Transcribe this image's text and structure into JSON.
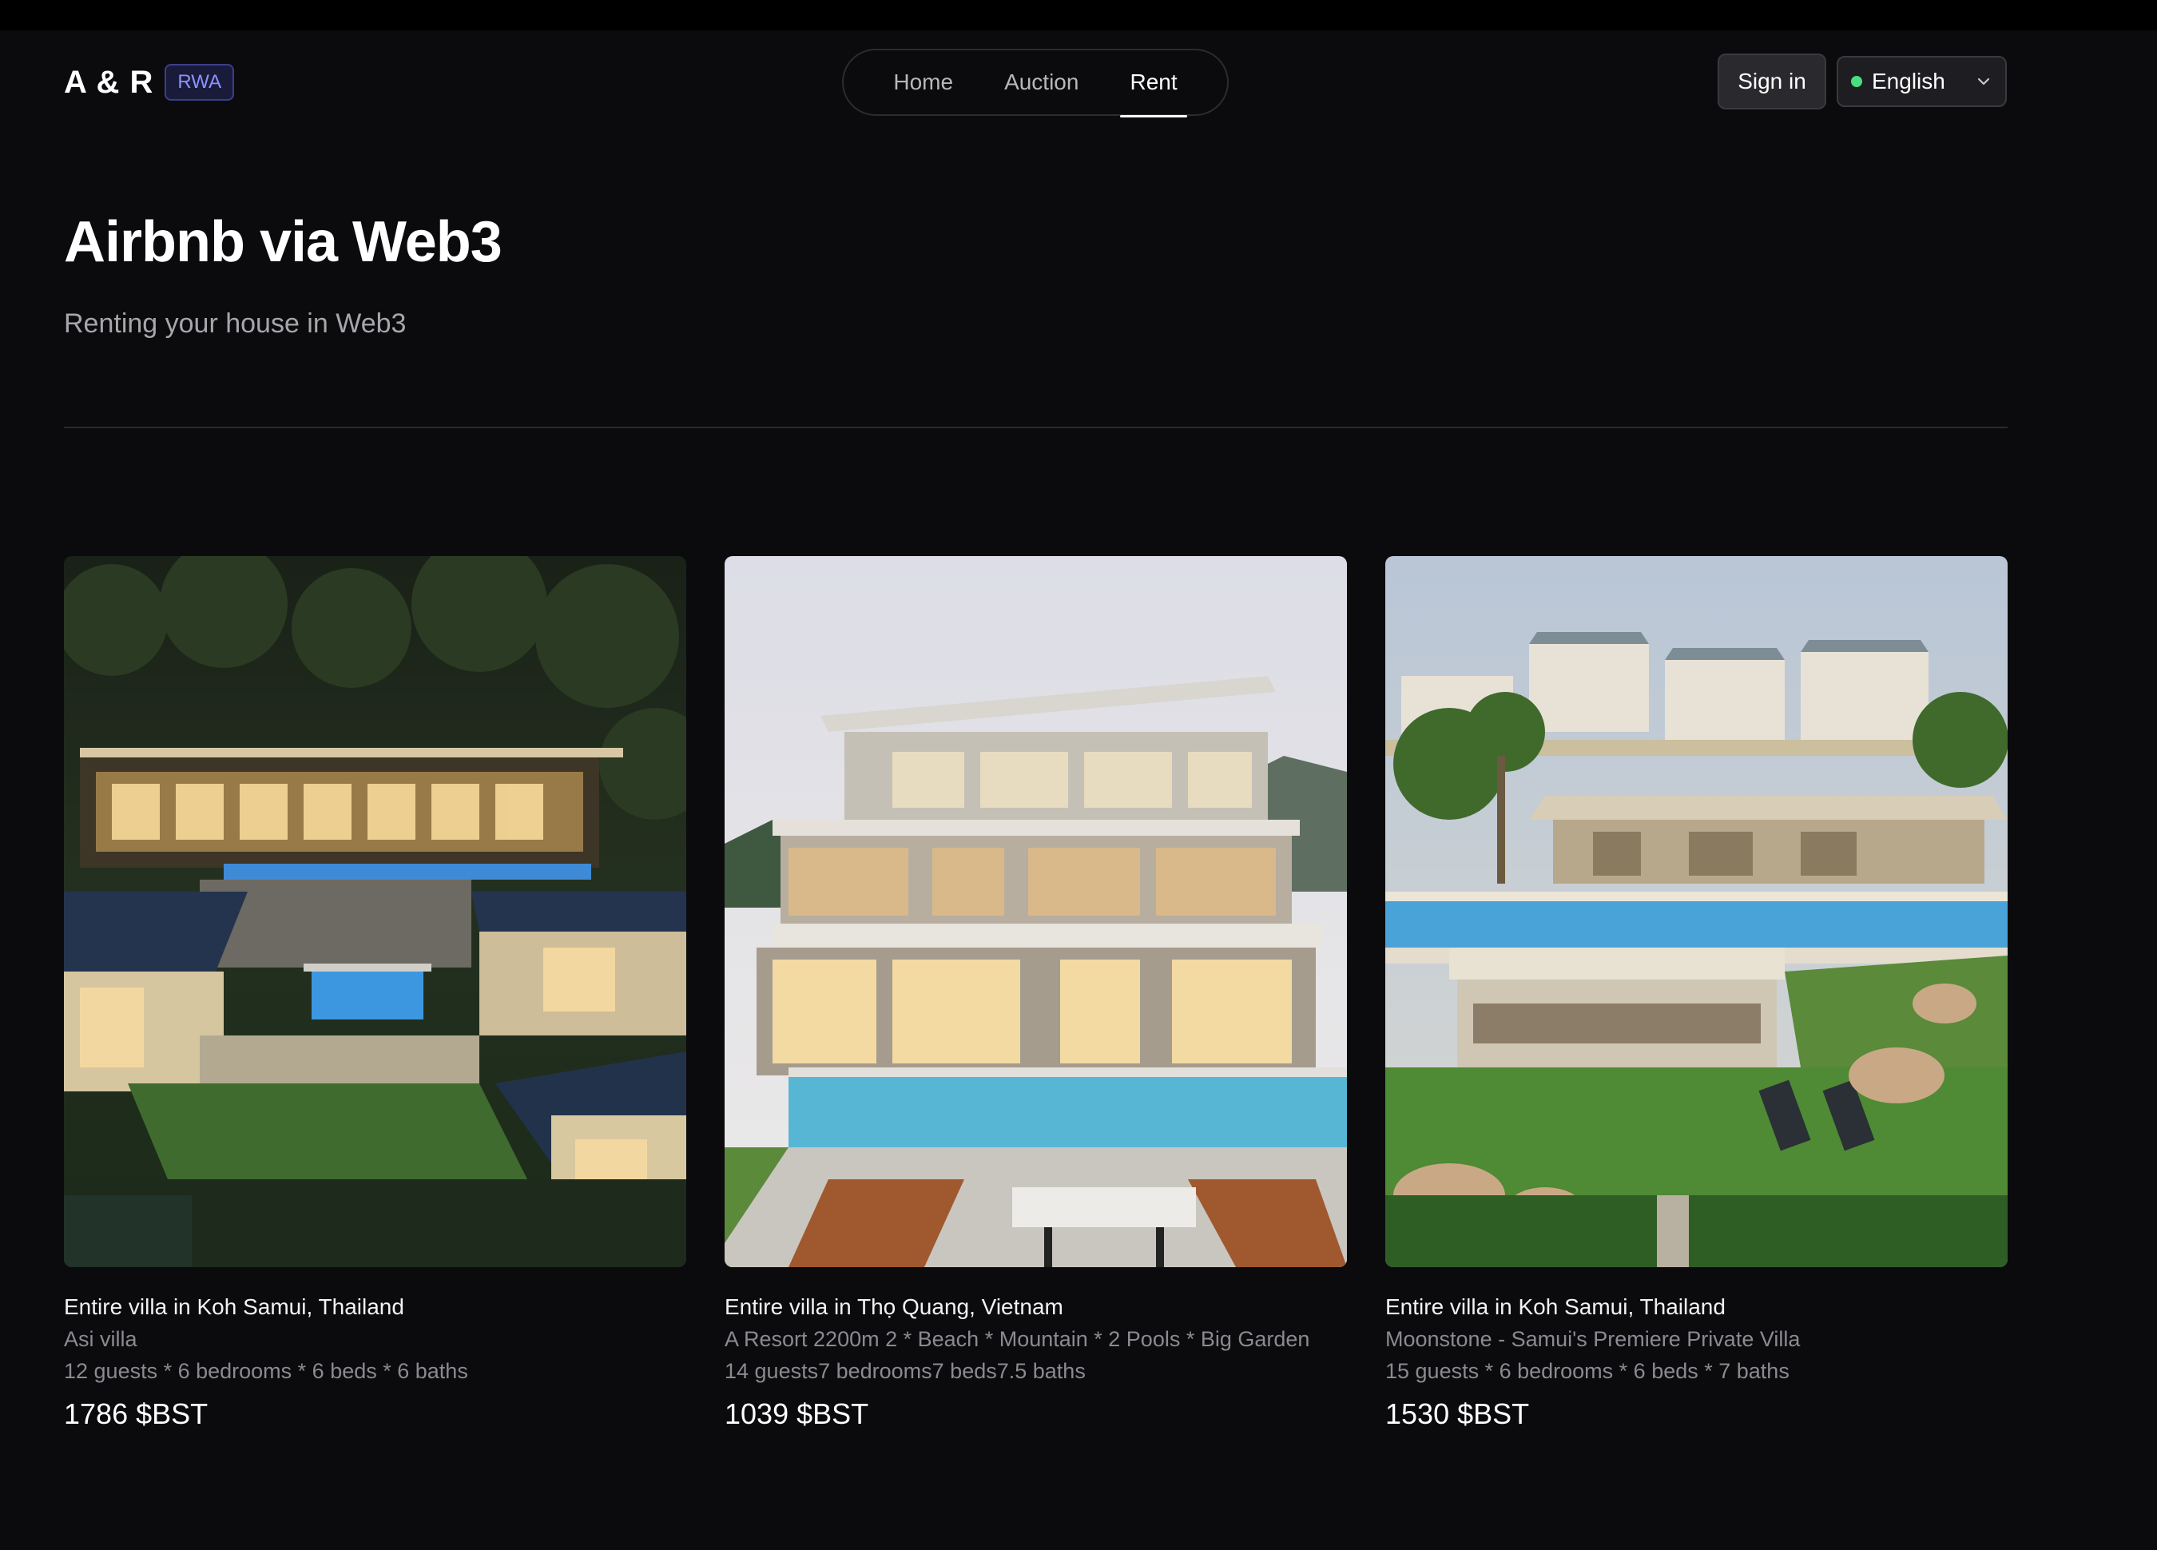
{
  "header": {
    "brand": "A & R",
    "badge": "RWA",
    "nav": [
      {
        "label": "Home",
        "active": false
      },
      {
        "label": "Auction",
        "active": false
      },
      {
        "label": "Rent",
        "active": true
      }
    ],
    "sign_in": "Sign in",
    "language": {
      "selected": "English",
      "status_color": "#4ade80"
    }
  },
  "hero": {
    "title": "Airbnb via Web3",
    "subtitle": "Renting your house in Web3"
  },
  "listings": [
    {
      "title": "Entire villa in Koh Samui, Thailand",
      "name": "Asi villa",
      "details": "12 guests * 6 bedrooms * 6 beds * 6 baths",
      "price": "1786 $BST"
    },
    {
      "title": "Entire villa in Thọ Quang, Vietnam",
      "name": "A Resort 2200m 2 * Beach * Mountain * 2 Pools * Big Garden",
      "details": "14 guests7 bedrooms7 beds7.5 baths",
      "price": "1039 $BST"
    },
    {
      "title": "Entire villa in Koh Samui, Thailand",
      "name": "Moonstone - Samui's Premiere Private Villa",
      "details": "15 guests * 6 bedrooms * 6 beds * 7 baths",
      "price": "1530 $BST"
    }
  ],
  "colors": {
    "background": "#0b0b0e",
    "accent_badge": "#8b93ff",
    "muted_text": "#8a8a90"
  }
}
